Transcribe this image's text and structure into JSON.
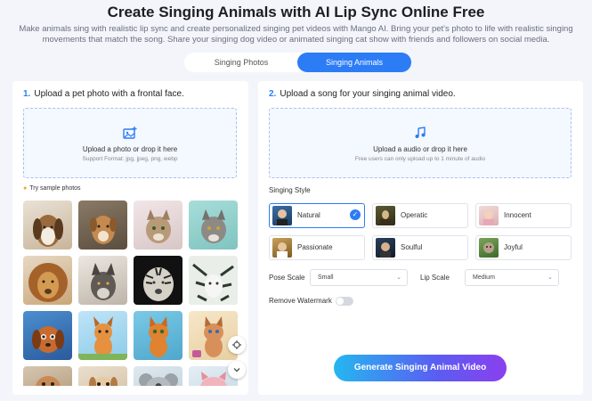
{
  "header": {
    "title": "Create Singing Animals with AI Lip Sync Online Free",
    "subtitle": "Make animals sing with realistic lip sync and create personalized singing pet videos with Mango AI. Bring your pet's photo to life with realistic singing movements that match the song. Share your singing dog video or animated singing cat show with friends and followers on social media."
  },
  "tabs": {
    "photos": "Singing Photos",
    "animals": "Singing Animals",
    "active": "Singing Animals"
  },
  "left": {
    "step_num": "1.",
    "step_text": "Upload a pet photo with a frontal face.",
    "drop_title": "Upload a photo or drop it here",
    "drop_sub": "Support Format: jpg, jpeg, png, webp",
    "sample_label": "Try sample photos",
    "samples": [
      "beagle-dog",
      "brown-puppy",
      "tabby-cat",
      "grey-tabby-cat",
      "lion",
      "grey-wolf",
      "black-white-tiger",
      "white-tiger-painting",
      "cartoon-dog",
      "cartoon-fox-dog",
      "cartoon-ginger-cat",
      "cartoon-tabby-cat",
      "cartoon-animal",
      "cartoon-puppy",
      "cartoon-koala",
      "cartoon-pig"
    ]
  },
  "right": {
    "step_num": "2.",
    "step_text": "Upload a song for your singing animal video.",
    "drop_title": "Upload a audio or drop it here",
    "drop_sub": "Free users can only upload up to 1 minute of audio",
    "style_label": "Singing Style",
    "styles": [
      {
        "name": "Natural",
        "selected": true
      },
      {
        "name": "Operatic",
        "selected": false
      },
      {
        "name": "Innocent",
        "selected": false
      },
      {
        "name": "Passionate",
        "selected": false
      },
      {
        "name": "Soulful",
        "selected": false
      },
      {
        "name": "Joyful",
        "selected": false
      }
    ],
    "pose_scale_label": "Pose Scale",
    "pose_scale_value": "Small",
    "lip_scale_label": "Lip Scale",
    "lip_scale_value": "Medium",
    "watermark_label": "Remove Watermark",
    "watermark_on": false,
    "generate_label": "Generate Singing Animal Video"
  },
  "colors": {
    "accent": "#2c7cf6",
    "page_bg": "#f3f5fb",
    "gradient_start": "#25b7f0",
    "gradient_end": "#8b3ff0"
  }
}
